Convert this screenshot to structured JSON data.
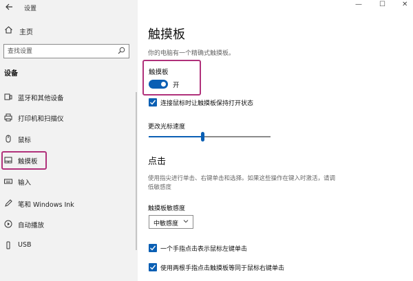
{
  "window": {
    "title": "设置",
    "back_icon": "back-arrow-icon",
    "minimize_glyph": "—",
    "maximize_glyph": "☐",
    "close_glyph": "✕"
  },
  "sidebar": {
    "home_label": "主页",
    "search_placeholder": "查找设置",
    "section_title": "设备",
    "items": [
      {
        "label": "蓝牙和其他设备",
        "icon": "bluetooth-icon"
      },
      {
        "label": "打印机和扫描仪",
        "icon": "printer-icon"
      },
      {
        "label": "鼠标",
        "icon": "mouse-icon"
      },
      {
        "label": "触摸板",
        "icon": "touchpad-icon"
      },
      {
        "label": "输入",
        "icon": "keyboard-icon"
      },
      {
        "label": "笔和 Windows Ink",
        "icon": "pen-icon"
      },
      {
        "label": "自动播放",
        "icon": "autoplay-icon"
      },
      {
        "label": "USB",
        "icon": "usb-icon"
      }
    ],
    "selected_index": 3
  },
  "main": {
    "title": "触摸板",
    "description": "你的电脑有一个精确式触摸板。",
    "touchpad_toggle": {
      "label": "触摸板",
      "state_label": "开",
      "on": true
    },
    "keep_on_checkbox": {
      "label": "连接鼠标时让触摸板保持打开状态",
      "checked": true
    },
    "cursor_speed": {
      "label": "更改光标速度",
      "value_fraction": 0.44
    },
    "click_section": {
      "title": "点击",
      "description": "使用指尖进行单击、右键单击和选择。如果这些操作在键入时激活，请调低敏感度"
    },
    "sensitivity": {
      "label": "触摸板敏感度",
      "selected": "中敏感度"
    },
    "single_tap_checkbox": {
      "label": "一个手指点击表示鼠标左键单击",
      "checked": true
    },
    "two_finger_checkbox": {
      "label": "使用两根手指点击触摸板等同于鼠标右键单击",
      "checked": true
    }
  },
  "colors": {
    "accent": "#0a5fb4",
    "highlight_box": "#b0307a",
    "sidebar_bg": "#f2f2f2"
  }
}
